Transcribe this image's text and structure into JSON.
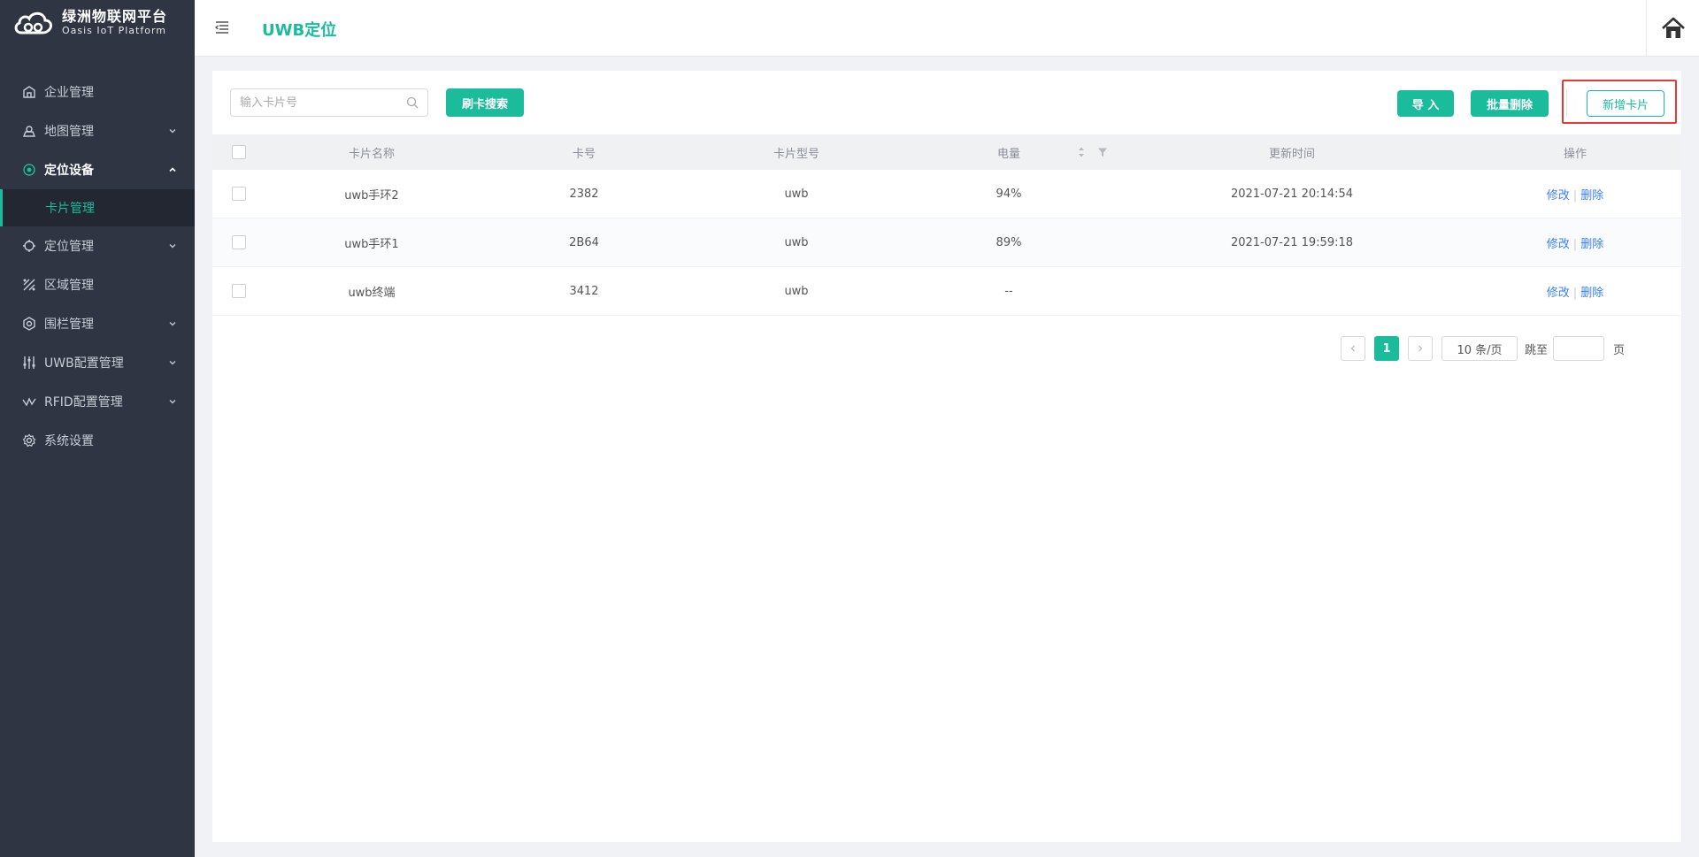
{
  "brand": {
    "name_cn": "绿洲物联网平台",
    "name_en": "Oasis IoT Platform"
  },
  "sidebar": {
    "items": [
      {
        "label": "企业管理",
        "icon": "enterprise-icon",
        "has_arrow": false
      },
      {
        "label": "地图管理",
        "icon": "map-icon",
        "has_arrow": true
      },
      {
        "label": "定位设备",
        "icon": "locator-device-icon",
        "has_arrow": true,
        "expanded": true
      },
      {
        "label": "定位管理",
        "icon": "crosshair-icon",
        "has_arrow": true
      },
      {
        "label": "区域管理",
        "icon": "region-icon",
        "has_arrow": false
      },
      {
        "label": "围栏管理",
        "icon": "fence-icon",
        "has_arrow": true
      },
      {
        "label": "UWB配置管理",
        "icon": "sliders-icon",
        "has_arrow": true
      },
      {
        "label": "RFID配置管理",
        "icon": "signal-icon",
        "has_arrow": true
      },
      {
        "label": "系统设置",
        "icon": "gear-icon",
        "has_arrow": false
      }
    ],
    "submenu": {
      "label": "卡片管理"
    }
  },
  "header": {
    "title": "UWB定位",
    "home_icon": "home-icon"
  },
  "toolbar": {
    "search_placeholder": "输入卡片号",
    "swipe_search_label": "刷卡搜索",
    "import_label": "导 入",
    "bulk_delete_label": "批量删除",
    "add_card_label": "新增卡片"
  },
  "table": {
    "columns": {
      "name": "卡片名称",
      "number": "卡号",
      "model": "卡片型号",
      "battery": "电量",
      "updated": "更新时间",
      "actions": "操作"
    },
    "rows": [
      {
        "name": "uwb手环2",
        "number": "2382",
        "model": "uwb",
        "battery": "94%",
        "updated": "2021-07-21 20:14:54"
      },
      {
        "name": "uwb手环1",
        "number": "2B64",
        "model": "uwb",
        "battery": "89%",
        "updated": "2021-07-21 19:59:18"
      },
      {
        "name": "uwb终端",
        "number": "3412",
        "model": "uwb",
        "battery": "--",
        "updated": ""
      }
    ],
    "edit_label": "修改",
    "delete_label": "删除",
    "separator": "|"
  },
  "pagination": {
    "current": "1",
    "page_size": "10 条/页",
    "jump_label": "跳至",
    "page_label": "页"
  },
  "colors": {
    "accent": "#1abc9c",
    "sidebar_bg": "#2f3542",
    "link": "#3b7ff5",
    "highlight": "#e53935"
  }
}
